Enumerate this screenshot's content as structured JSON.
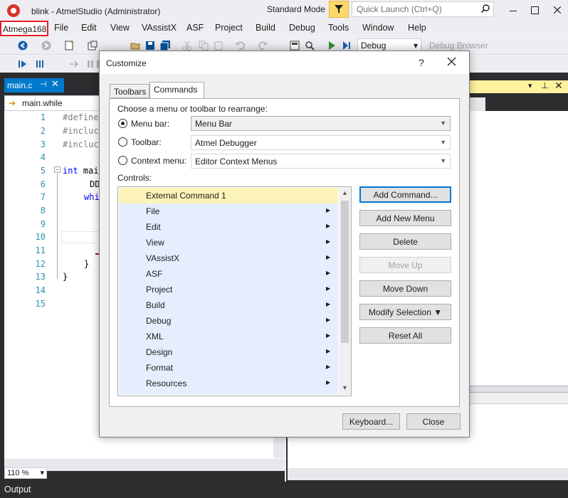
{
  "titlebar": {
    "title": "blink - AtmelStudio (Administrator)",
    "mode": "Standard Mode",
    "quick_launch_placeholder": "Quick Launch (Ctrl+Q)"
  },
  "menubar": {
    "device": "Atmega168",
    "items": [
      "File",
      "Edit",
      "View",
      "VAssistX",
      "ASF",
      "Project",
      "Build",
      "Debug",
      "Tools",
      "Window",
      "Help"
    ]
  },
  "toolbar": {
    "configuration": "Debug",
    "debug_browser": "Debug Browser"
  },
  "editor": {
    "tab_label": "main.c",
    "scope": "main.while",
    "zoom": "110 %",
    "line_numbers": [
      "1",
      "2",
      "3",
      "4",
      "5",
      "6",
      "7",
      "8",
      "9",
      "10",
      "11",
      "12",
      "13",
      "14",
      "15"
    ],
    "lines": {
      "l1": "#define",
      "l2": "#incluc",
      "l3": "#incluc",
      "l5_kw": "int",
      "l5_rest": " mai",
      "l6": "DD",
      "l7": "whi",
      "l12": "}",
      "l13": "}"
    }
  },
  "output": {
    "label": "Output"
  },
  "dialog": {
    "title": "Customize",
    "help": "?",
    "tabs": {
      "toolbars": "Toolbars",
      "commands": "Commands"
    },
    "prompt": "Choose a menu or toolbar to rearrange:",
    "options": {
      "menu_bar_label": "Menu bar:",
      "menu_bar_value": "Menu Bar",
      "toolbar_label": "Toolbar:",
      "toolbar_value": "Atmel Debugger",
      "context_label": "Context menu:",
      "context_value": "Editor Context Menus"
    },
    "controls_label": "Controls:",
    "controls": [
      "External Command 1",
      "File",
      "Edit",
      "View",
      "VAssistX",
      "ASF",
      "Project",
      "Build",
      "Debug",
      "XML",
      "Design",
      "Format",
      "Resources"
    ],
    "buttons": {
      "add_command": "Add Command...",
      "add_new_menu": "Add New Menu",
      "delete": "Delete",
      "move_up": "Move Up",
      "move_down": "Move Down",
      "modify_selection": "Modify Selection ▼",
      "reset_all": "Reset All",
      "keyboard": "Keyboard...",
      "close": "Close"
    }
  },
  "colors": {
    "accent": "#007acc",
    "highlight": "#e41e2a",
    "selection": "#fbf3b8",
    "list_bg": "#e5eefc"
  }
}
